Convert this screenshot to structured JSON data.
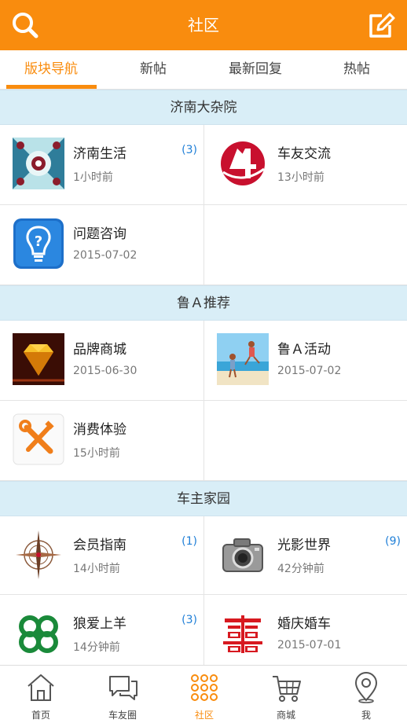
{
  "header": {
    "title": "社区",
    "left_icon": "search-icon",
    "right_icon": "compose-icon"
  },
  "tabs": [
    {
      "label": "版块导航",
      "active": true
    },
    {
      "label": "新帖",
      "active": false
    },
    {
      "label": "最新回复",
      "active": false
    },
    {
      "label": "热帖",
      "active": false
    }
  ],
  "sections": [
    {
      "title": "济南大杂院",
      "items": [
        {
          "name": "济南生活",
          "time": "1小时前",
          "count": "(3)",
          "icon": "kaleidoscope-thumb"
        },
        {
          "name": "车友交流",
          "time": "13小时前",
          "count": "",
          "icon": "red-4-logo"
        },
        {
          "name": "问题咨询",
          "time": "2015-07-02",
          "count": "",
          "icon": "lightbulb-question-icon"
        }
      ]
    },
    {
      "title": "鲁Ａ推荐",
      "items": [
        {
          "name": "品牌商城",
          "time": "2015-06-30",
          "count": "",
          "icon": "diamond-thumb"
        },
        {
          "name": "鲁Ａ活动",
          "time": "2015-07-02",
          "count": "",
          "icon": "beach-photo-thumb"
        },
        {
          "name": "消费体验",
          "time": "15小时前",
          "count": "",
          "icon": "tools-icon"
        }
      ]
    },
    {
      "title": "车主家园",
      "items": [
        {
          "name": "会员指南",
          "time": "14小时前",
          "count": "(1)",
          "icon": "compass-icon"
        },
        {
          "name": "光影世界",
          "time": "42分钟前",
          "count": "(9)",
          "icon": "camera-icon"
        },
        {
          "name": "狼爱上羊",
          "time": "14分钟前",
          "count": "(3)",
          "icon": "green-knot-icon"
        },
        {
          "name": "婚庆婚车",
          "time": "2015-07-01",
          "count": "",
          "icon": "double-happiness-icon"
        }
      ]
    }
  ],
  "bottom_nav": [
    {
      "label": "首页",
      "icon": "home-icon",
      "active": false
    },
    {
      "label": "车友圈",
      "icon": "chat-icon",
      "active": false
    },
    {
      "label": "社区",
      "icon": "grid-dots-icon",
      "active": true
    },
    {
      "label": "商城",
      "icon": "cart-icon",
      "active": false
    },
    {
      "label": "我",
      "icon": "location-pin-icon",
      "active": false
    }
  ],
  "colors": {
    "accent": "#f98c0e",
    "section_bg": "#d9eef7",
    "count_blue": "#1f7fd7"
  }
}
